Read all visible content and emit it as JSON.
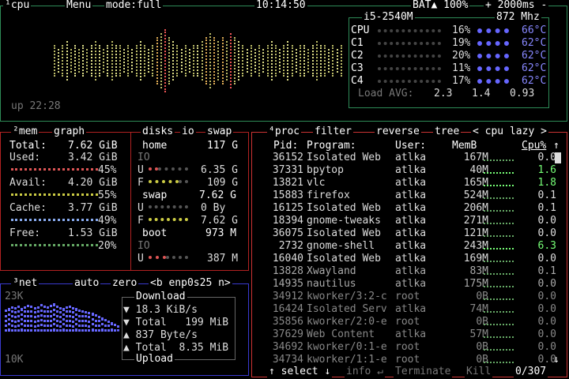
{
  "top": {
    "cpu_tag": "¹cpu",
    "menu": "Menu",
    "mode": "mode:full",
    "clock": "10:14:50",
    "battery": "BAT▲ 100%",
    "interval": "+ 2000ms -",
    "uptime": "up 22:28"
  },
  "cpu_info": {
    "model": "i5-2540M",
    "freq": "872 Mhz",
    "rows": [
      {
        "name": "CPU",
        "pct": "16%",
        "temp": "66°C"
      },
      {
        "name": "C1",
        "pct": "19%",
        "temp": "62°C"
      },
      {
        "name": "C2",
        "pct": "20%",
        "temp": "62°C"
      },
      {
        "name": "C3",
        "pct": "11%",
        "temp": "62°C"
      },
      {
        "name": "C4",
        "pct": "17%",
        "temp": "62°C"
      }
    ],
    "load_label": "Load AVG:",
    "load": [
      "2.3",
      "1.4",
      "0.93"
    ]
  },
  "mem": {
    "tabs": [
      "²mem",
      "graph"
    ],
    "total_label": "Total:",
    "total": "7.62 GiB",
    "used_label": "Used:",
    "used": "3.42 GiB",
    "used_pct": "45%",
    "avail_label": "Avail:",
    "avail": "4.20 GiB",
    "avail_pct": "55%",
    "cache_label": "Cache:",
    "cache": "3.77 GiB",
    "cache_pct": "49%",
    "free_label": "Free:",
    "free": "1.53 GiB",
    "free_pct": "20%"
  },
  "disks": {
    "tabs": [
      "disks",
      "io",
      "swap"
    ],
    "home_label": "home",
    "home_size": "117 G",
    "home_io": "IO",
    "home_u": "U",
    "home_used": "6.35 G",
    "home_f": "F",
    "home_free": "109 G",
    "swap_label": "swap",
    "swap_size": "7.62 G",
    "swap_u": "U",
    "swap_used": "0 By",
    "swap_f": "F",
    "swap_free": "7.62 G",
    "boot_label": "boot",
    "boot_size": "973 M",
    "boot_io": "IO",
    "boot_u": "U",
    "boot_used": "387 M"
  },
  "net": {
    "tag": "³net",
    "auto": "auto",
    "zero": "zero",
    "iface": "<b enp0s25 n>",
    "scale_top": "23K",
    "scale_bottom": "10K",
    "download_label": "Download",
    "dl_rate": "▼ 18.3 KiB/s",
    "dl_total": "▼ Total   199 MiB",
    "ul_rate": "▲ 837 Byte/s",
    "ul_total": "▲ Total  8.35 MiB",
    "upload_label": "Upload"
  },
  "proc": {
    "tabs": [
      "⁴proc",
      "filter",
      "reverse",
      "tree"
    ],
    "sort": "< cpu lazy >",
    "headers": {
      "pid": "Pid:",
      "program": "Program:",
      "user": "User:",
      "mem": "MemB",
      "cpu": "Cpu%"
    },
    "rows": [
      {
        "pid": "36152",
        "program": "Isolated Web",
        "user": "atlka",
        "mem": "167M",
        "cpu": "0.0"
      },
      {
        "pid": "37331",
        "program": "bpytop",
        "user": "atlka",
        "mem": "40M",
        "cpu": "1.6"
      },
      {
        "pid": "13821",
        "program": "vlc",
        "user": "atlka",
        "mem": "165M",
        "cpu": "1.8"
      },
      {
        "pid": "15883",
        "program": "firefox",
        "user": "atlka",
        "mem": "524M",
        "cpu": "0.1"
      },
      {
        "pid": "16125",
        "program": "Isolated Web",
        "user": "atlka",
        "mem": "206M",
        "cpu": "0.1"
      },
      {
        "pid": "18394",
        "program": "gnome-tweaks",
        "user": "atlka",
        "mem": "271M",
        "cpu": "0.0"
      },
      {
        "pid": "36075",
        "program": "Isolated Web",
        "user": "atlka",
        "mem": "121M",
        "cpu": "0.0"
      },
      {
        "pid": "2732",
        "program": "gnome-shell",
        "user": "atlka",
        "mem": "243M",
        "cpu": "6.3"
      },
      {
        "pid": "16040",
        "program": "Isolated Web",
        "user": "atlka",
        "mem": "169M",
        "cpu": "0.0"
      },
      {
        "pid": "13828",
        "program": "Xwayland",
        "user": "atlka",
        "mem": "83M",
        "cpu": "0.1"
      },
      {
        "pid": "14935",
        "program": "nautilus",
        "user": "atlka",
        "mem": "175M",
        "cpu": "0.0"
      },
      {
        "pid": "34912",
        "program": "kworker/3:2-c",
        "user": "root",
        "mem": "0B",
        "cpu": "0.0"
      },
      {
        "pid": "16424",
        "program": "Isolated Serv",
        "user": "atlka",
        "mem": "74M",
        "cpu": "0.0"
      },
      {
        "pid": "35856",
        "program": "kworker/2:0-e",
        "user": "root",
        "mem": "0B",
        "cpu": "0.0"
      },
      {
        "pid": "37629",
        "program": "Web Content",
        "user": "atlka",
        "mem": "57M",
        "mem2": "",
        "cpu": "0.0"
      },
      {
        "pid": "34692",
        "program": "kworker/0:1-e",
        "user": "root",
        "mem": "0B",
        "cpu": "0.0"
      },
      {
        "pid": "34734",
        "program": "kworker/1:1-e",
        "user": "root",
        "mem": "0B",
        "cpu": "0.0"
      }
    ],
    "select": "↑ select ↓",
    "info": "info ↵",
    "terminate": "Terminate",
    "kill": "Kill",
    "count": "0/307"
  },
  "colors": {
    "cpu_border": "#2e8b57",
    "mem_border": "#b22222",
    "net_border": "#3a3acf",
    "proc_border": "#cc3333"
  }
}
